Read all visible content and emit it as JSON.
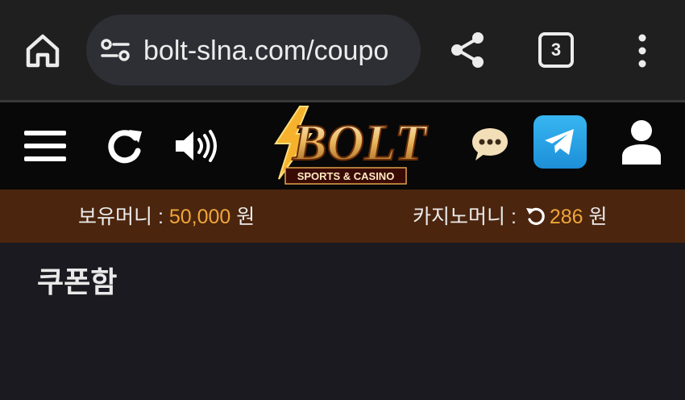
{
  "browser": {
    "url": "bolt-slna.com/coupo",
    "tab_count": "3"
  },
  "site": {
    "logo_main": "BOLT",
    "logo_sub": "SPORTS & CASINO"
  },
  "money": {
    "holding_label": "보유머니 : ",
    "holding_amount": "50,000",
    "holding_unit": " 원",
    "casino_label": "카지노머니 : ",
    "casino_amount": "286",
    "casino_unit": " 원"
  },
  "page": {
    "title": "쿠폰함"
  },
  "colors": {
    "accent": "#f0a63a",
    "money_bar": "#4b250e",
    "telegram": "#2aa3e6"
  }
}
